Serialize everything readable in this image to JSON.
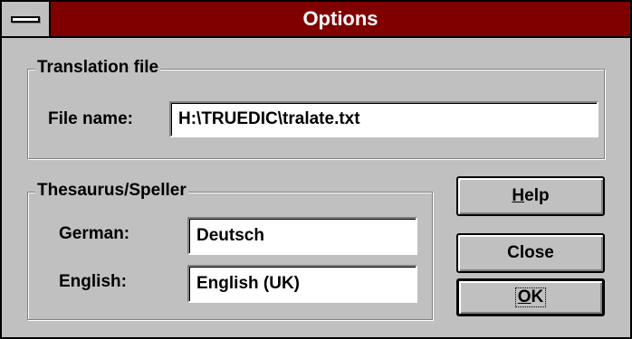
{
  "window": {
    "title": "Options"
  },
  "translation_group": {
    "label": "Translation file",
    "file_name_label": "File name:",
    "file_name_value": "H:\\TRUEDIC\\tralate.txt"
  },
  "thesaurus_group": {
    "label": "Thesaurus/Speller",
    "german_label": "German:",
    "german_value": "Deutsch",
    "english_label": "English:",
    "english_value": "English (UK)"
  },
  "buttons": {
    "help_mnemonic": "H",
    "help_rest": "elp",
    "close": "Close",
    "ok_mnemonic": "O",
    "ok_rest": "K"
  },
  "colors": {
    "titlebar": "#800000",
    "face": "#c0c0c0"
  },
  "icons": {
    "system_menu": "system-menu-icon"
  }
}
